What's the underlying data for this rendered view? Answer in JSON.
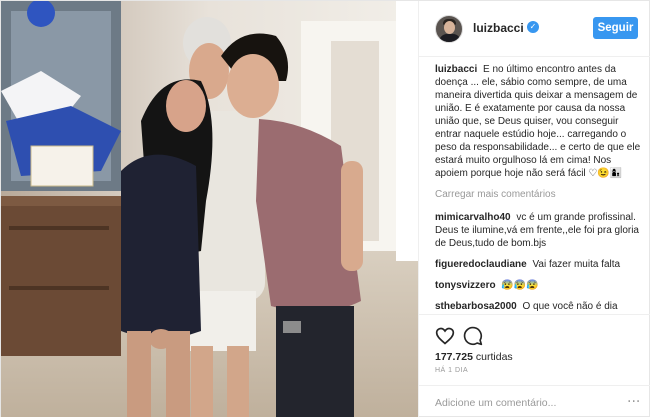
{
  "header": {
    "username": "luizbacci",
    "verified_icon": "verified-badge-icon",
    "follow_label": "Seguir",
    "accent": "#3897f0"
  },
  "caption": {
    "username": "luizbacci",
    "text": "E no último encontro antes da doença ... ele, sábio como sempre, de uma maneira divertida quis deixar a mensagem de união. E é exatamente por causa da nossa união que, se Deus quiser, vou conseguir entrar naquele estúdio hoje... carregando o peso da responsabilidade... e certo de que ele estará muito orgulhoso lá em cima! Nos apoiem porque hoje não será fácil ♡😉👩‍👦"
  },
  "load_more_label": "Carregar mais comentários",
  "comments": [
    {
      "username": "mimicarvalho40",
      "text": "vc é um grande profissinal. Deus te ilumine,vá em frente,,ele foi pra gloria de Deus,tudo de bom.bjs"
    },
    {
      "username": "figueredoclaudiane",
      "text": "Vai fazer muita falta"
    },
    {
      "username": "tonysvizzero",
      "text": "😰😰😰"
    },
    {
      "username": "sthebarbosa2000",
      "text": "O que você não é dia"
    }
  ],
  "actions": {
    "like_icon": "heart-icon",
    "comment_icon": "comment-bubble-icon",
    "likes_count": "177.725",
    "likes_label": "curtidas",
    "timestamp": "HÁ 1 DIA"
  },
  "add_comment": {
    "placeholder": "Adicione um comentário...",
    "more_icon": "more-options-icon"
  }
}
